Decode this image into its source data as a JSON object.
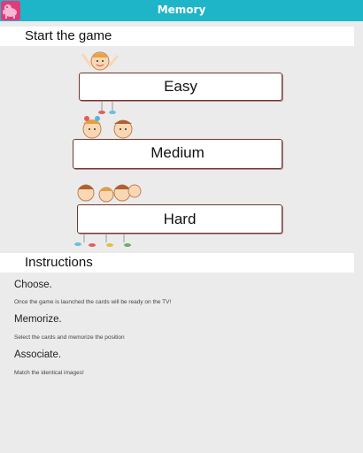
{
  "app": {
    "title": "Memory",
    "brand_color": "#1fb5c9",
    "icon": "elephant-icon"
  },
  "start_section": {
    "heading": "Start the game",
    "buttons": [
      {
        "label": "Easy"
      },
      {
        "label": "Medium"
      },
      {
        "label": "Hard"
      }
    ]
  },
  "instructions_section": {
    "heading": "Instructions",
    "steps": [
      {
        "title": "Choose.",
        "description": "Once the game is launched the cards will be ready on the TV!"
      },
      {
        "title": "Memorize.",
        "description": "Select the cards and memorize the position"
      },
      {
        "title": "Associate.",
        "description": "Match the identical images!"
      }
    ]
  }
}
